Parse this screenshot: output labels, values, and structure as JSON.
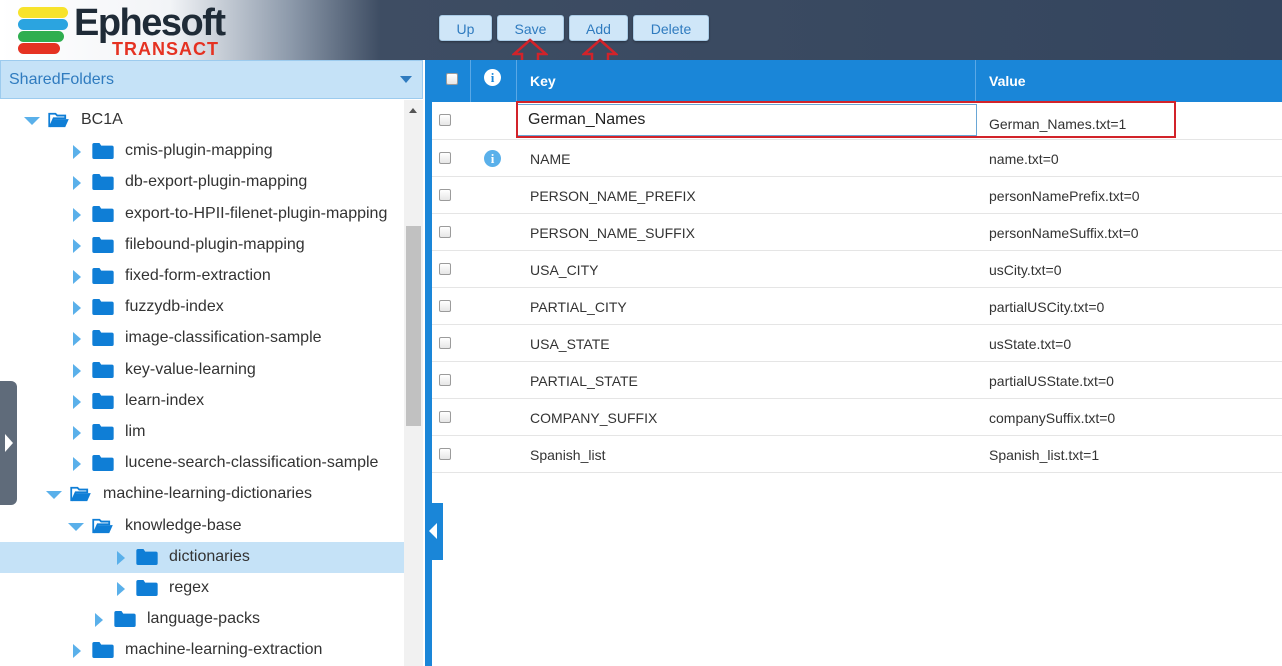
{
  "header": {
    "logo": {
      "name": "Ephesoft",
      "sub": "TRANSACT"
    },
    "toolbar": [
      {
        "label": "Up"
      },
      {
        "label": "Save"
      },
      {
        "label": "Add"
      },
      {
        "label": "Delete"
      }
    ]
  },
  "left_panel": {
    "folder_dropdown": {
      "selected": "SharedFolders"
    },
    "tree": [
      {
        "label": "BC1A",
        "depth": 0,
        "expanded": true,
        "selected": false
      },
      {
        "label": "cmis-plugin-mapping",
        "depth": 1,
        "expanded": false,
        "selected": false
      },
      {
        "label": "db-export-plugin-mapping",
        "depth": 1,
        "expanded": false,
        "selected": false
      },
      {
        "label": "export-to-HPII-filenet-plugin-mapping",
        "depth": 1,
        "expanded": false,
        "selected": false
      },
      {
        "label": "filebound-plugin-mapping",
        "depth": 1,
        "expanded": false,
        "selected": false
      },
      {
        "label": "fixed-form-extraction",
        "depth": 1,
        "expanded": false,
        "selected": false
      },
      {
        "label": "fuzzydb-index",
        "depth": 1,
        "expanded": false,
        "selected": false
      },
      {
        "label": "image-classification-sample",
        "depth": 1,
        "expanded": false,
        "selected": false
      },
      {
        "label": "key-value-learning",
        "depth": 1,
        "expanded": false,
        "selected": false
      },
      {
        "label": "learn-index",
        "depth": 1,
        "expanded": false,
        "selected": false
      },
      {
        "label": "lim",
        "depth": 1,
        "expanded": false,
        "selected": false
      },
      {
        "label": "lucene-search-classification-sample",
        "depth": 1,
        "expanded": false,
        "selected": false
      },
      {
        "label": "machine-learning-dictionaries",
        "depth": 1,
        "expanded": true,
        "selected": false
      },
      {
        "label": "knowledge-base",
        "depth": 2,
        "expanded": true,
        "selected": false
      },
      {
        "label": "dictionaries",
        "depth": 3,
        "expanded": false,
        "selected": true
      },
      {
        "label": "regex",
        "depth": 3,
        "expanded": false,
        "selected": false
      },
      {
        "label": "language-packs",
        "depth": 2,
        "expanded": false,
        "selected": false
      },
      {
        "label": "machine-learning-extraction",
        "depth": 1,
        "expanded": false,
        "selected": false
      }
    ]
  },
  "grid": {
    "columns": {
      "key": "Key",
      "value": "Value"
    },
    "editing_row": {
      "key": "German_Names",
      "value": "German_Names.txt=1"
    },
    "rows": [
      {
        "key": "NAME",
        "value": "name.txt=0",
        "info": true
      },
      {
        "key": "PERSON_NAME_PREFIX",
        "value": "personNamePrefix.txt=0",
        "info": false
      },
      {
        "key": "PERSON_NAME_SUFFIX",
        "value": "personNameSuffix.txt=0",
        "info": false
      },
      {
        "key": "USA_CITY",
        "value": "usCity.txt=0",
        "info": false
      },
      {
        "key": "PARTIAL_CITY",
        "value": "partialUSCity.txt=0",
        "info": false
      },
      {
        "key": "USA_STATE",
        "value": "usState.txt=0",
        "info": false
      },
      {
        "key": "PARTIAL_STATE",
        "value": "partialUSState.txt=0",
        "info": false
      },
      {
        "key": "COMPANY_SUFFIX",
        "value": "companySuffix.txt=0",
        "info": false
      },
      {
        "key": "Spanish_list",
        "value": "Spanish_list.txt=1",
        "info": false
      }
    ]
  },
  "colors": {
    "accent": "#1a86d8",
    "selection": "#c5e2f7",
    "highlight": "#d2232a",
    "folder": "#0f7ed6"
  }
}
